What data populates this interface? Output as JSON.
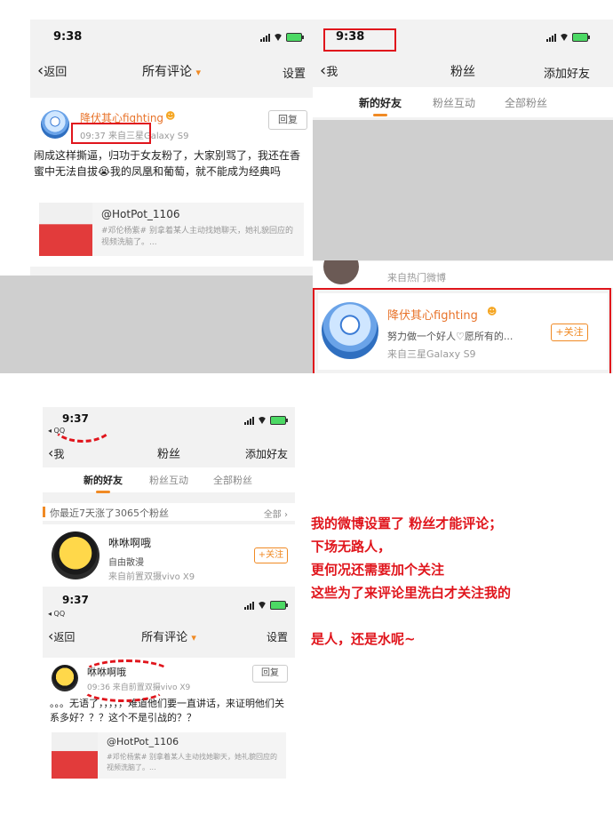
{
  "panel1": {
    "time": "9:38",
    "nav": {
      "back": "返回",
      "title": "所有评论",
      "right": "设置"
    },
    "comment": {
      "name": "降伏其心fighting",
      "meta": "09:37  来自三星Galaxy S9",
      "reply": "回复",
      "text": "闹成这样撕逼，归功于女友粉了，大家别骂了，我还在香蜜中无法自拔😭我的凤凰和葡萄，就不能成为经典吗",
      "quote_handle": "@HotPot_1106",
      "quote_text": "#邓伦杨紫# 别拿着某人主动找她聊天，她礼貌回应的视频洗脑了。..."
    }
  },
  "panel2": {
    "time": "9:38",
    "nav": {
      "back": "我",
      "title": "粉丝",
      "right": "添加好友"
    },
    "tabs": [
      "新的好友",
      "粉丝互动",
      "全部粉丝"
    ],
    "hidden_text": "来自热门微博",
    "fan": {
      "name": "降伏其心fighting",
      "bio": "努力做一个好人♡愿所有的...",
      "source": "来自三星Galaxy S9",
      "follow": "+关注"
    }
  },
  "panel3": {
    "time": "9:37",
    "back_app": "◂ QQ",
    "nav": {
      "back": "我",
      "title": "粉丝",
      "right": "添加好友"
    },
    "tabs": [
      "新的好友",
      "粉丝互动",
      "全部粉丝"
    ],
    "banner": {
      "left": "你最近7天涨了3065个粉丝",
      "right": "全部 ›"
    },
    "fan": {
      "name": "咻咻啊哦",
      "bio": "自由散漫",
      "source": "来自前置双摄vivo X9",
      "follow": "+关注"
    }
  },
  "panel4": {
    "time": "9:37",
    "back_app": "◂ QQ",
    "nav": {
      "back": "返回",
      "title": "所有评论",
      "right": "设置"
    },
    "comment": {
      "name": "咻咻啊哦",
      "meta": "09:36  来自前置双摄vivo X9",
      "reply": "回复",
      "text": "。。。无语了，，，，，难道他们要一直讲话，来证明他们关系多好？？？这个不是引战的？？",
      "quote_handle": "@HotPot_1106",
      "quote_text": "#邓伦杨紫# 别拿着某人主动找她聊天，她礼貌回应的视频洗脑了。..."
    }
  },
  "note": "我的微博设置了 粉丝才能评论；\n下场无路人，\n更何况还需要加个关注\n这些为了来评论里洗白才关注我的\n\n是人，还是水呢~",
  "colors": {
    "accent": "#f08a24",
    "annotation": "#e0151c",
    "name": "#e8732a"
  }
}
